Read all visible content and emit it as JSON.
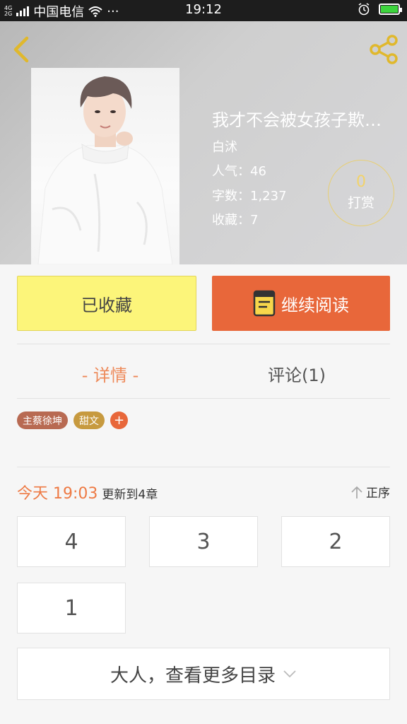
{
  "status_bar": {
    "network": "4G 2G",
    "carrier": "中国电信",
    "dots": "···",
    "time": "19:12"
  },
  "book": {
    "title": "我才不会被女孩子欺…",
    "author": "白沭",
    "popularity": "人气：46",
    "word_count": "字数：1,237",
    "favorites": "收藏：7",
    "reward_count": "0",
    "reward_label": "打赏"
  },
  "actions": {
    "favorited_label": "已收藏",
    "continue_label": "继续阅读"
  },
  "tabs": [
    {
      "label": "- 详情 -",
      "active": true
    },
    {
      "label": "评论(1)",
      "active": false
    }
  ],
  "tags": [
    "主蔡徐坤",
    "甜文"
  ],
  "add_tag": "+",
  "update": {
    "when": "今天 19:03",
    "what": "更新到4章",
    "sort_label": "正序"
  },
  "chapters": [
    "4",
    "3",
    "2",
    "1"
  ],
  "more_catalog": "大人，查看更多目录",
  "colors": {
    "accent_orange": "#e8673a",
    "favorite_yellow": "#fcf57a",
    "reward_gold": "#f2d36b"
  }
}
